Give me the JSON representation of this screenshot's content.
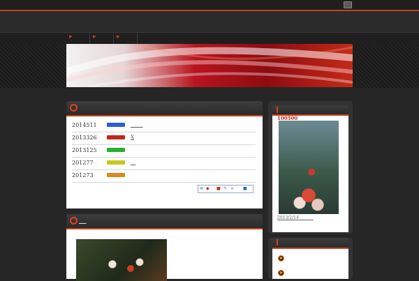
{
  "banner": {
    "colors": [
      "#f2f2f2",
      "#b8141e",
      "#c42a18"
    ]
  },
  "main_panel": {
    "rows": [
      {
        "number": "2014511",
        "color": "#2a5ed8",
        "link": "_____"
      },
      {
        "number": "2013326",
        "color": "#c0281c",
        "link": "X"
      },
      {
        "number": "2013125",
        "color": "#28b030",
        "link": ""
      },
      {
        "number": "201277",
        "color": "#c8c81c",
        "link": "__"
      },
      {
        "number": "201273",
        "color": "#d88a1c",
        "link": ""
      }
    ],
    "share_icons": [
      "mail-icon",
      "share-icon",
      "bookmark-icon",
      "pencil-icon",
      "link-icon",
      "info-icon"
    ]
  },
  "second_panel": {
    "title": "___"
  },
  "sidebar": {
    "photo_title": "100500",
    "photo_date": "2013/2/14",
    "photo_date_trail": "_______"
  },
  "nav": {
    "items": [
      "",
      "",
      ""
    ]
  }
}
